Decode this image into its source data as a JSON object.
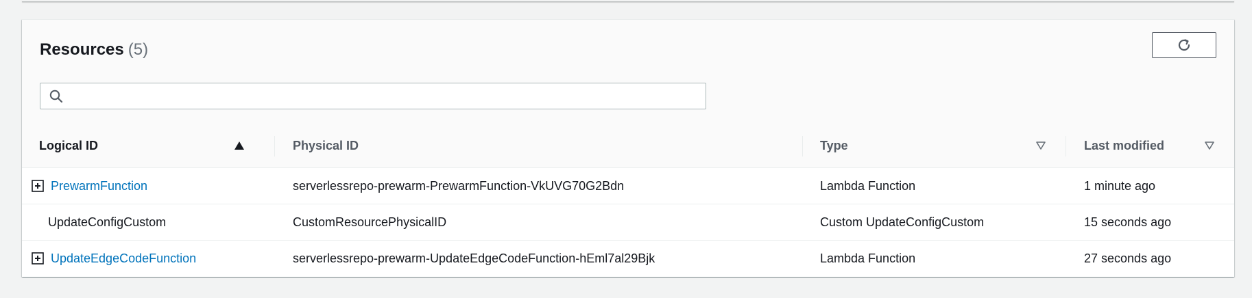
{
  "header": {
    "title": "Resources",
    "count": "(5)"
  },
  "search": {
    "placeholder": "",
    "value": ""
  },
  "icons": {
    "search": "search-icon",
    "refresh": "refresh-icon",
    "expand": "expand-plus-icon",
    "sort_asc": "sort-ascending-icon",
    "sort_desc": "sort-descending-icon"
  },
  "colors": {
    "link": "#0073bb",
    "text": "#16191f",
    "muted": "#545b64",
    "count": "#687078"
  },
  "table": {
    "columns": [
      {
        "label": "Logical ID",
        "sort": "ascending"
      },
      {
        "label": "Physical ID",
        "sort": "none"
      },
      {
        "label": "Type",
        "sort": "descending-inactive"
      },
      {
        "label": "Last modified",
        "sort": "descending-inactive"
      }
    ],
    "rows": [
      {
        "logical_id": "PrewarmFunction",
        "expandable": true,
        "physical_id": "serverlessrepo-prewarm-PrewarmFunction-VkUVG70G2Bdn",
        "type": "Lambda Function",
        "last_modified": "1 minute ago"
      },
      {
        "logical_id": "UpdateConfigCustom",
        "expandable": false,
        "physical_id": "CustomResourcePhysicalID",
        "type": "Custom UpdateConfigCustom",
        "last_modified": "15 seconds ago"
      },
      {
        "logical_id": "UpdateEdgeCodeFunction",
        "expandable": true,
        "physical_id": "serverlessrepo-prewarm-UpdateEdgeCodeFunction-hEml7al29Bjk",
        "type": "Lambda Function",
        "last_modified": "27 seconds ago"
      }
    ]
  }
}
